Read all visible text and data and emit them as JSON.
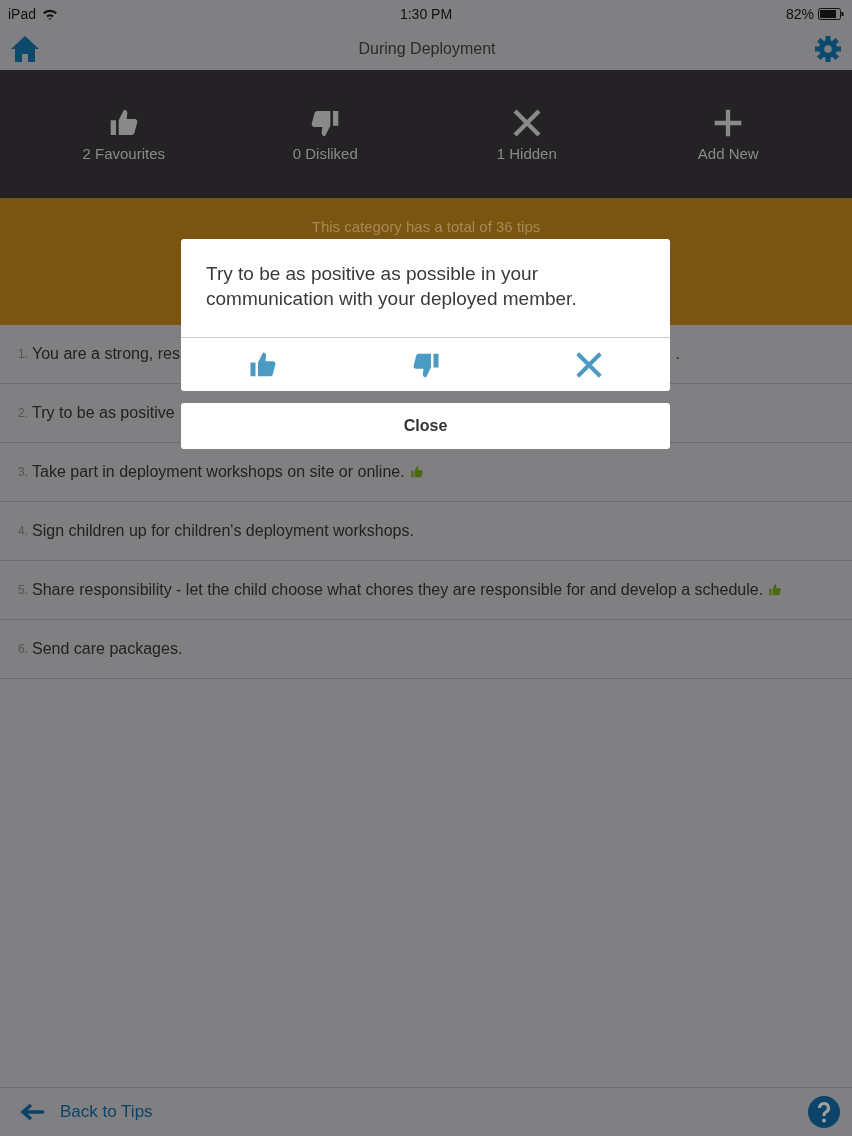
{
  "status_bar": {
    "carrier": "iPad",
    "time": "1:30 PM",
    "battery": "82%"
  },
  "header": {
    "title": "During Deployment"
  },
  "toolbar": [
    {
      "kind": "thumbs_up",
      "label": "2 Favourites"
    },
    {
      "kind": "thumbs_down",
      "label": "0 Disliked"
    },
    {
      "kind": "hidden",
      "label": "1 Hidden"
    },
    {
      "kind": "add",
      "label": "Add New"
    }
  ],
  "banner": {
    "text": "This category has a total of 36 tips"
  },
  "tips": [
    {
      "number": "1.",
      "text": "You are a strong, res",
      "tail": "."
    },
    {
      "number": "2.",
      "text": "Try to be as positive"
    },
    {
      "number": "3.",
      "text": "Take part in deployment workshops on site or online.",
      "favourite": true
    },
    {
      "number": "4.",
      "text": "Sign children up for children's deployment workshops.",
      "favourite": false
    },
    {
      "number": "5.",
      "text": "Share responsibility - let the child choose what chores they are responsible for and develop a schedule.",
      "favourite": true
    },
    {
      "number": "6.",
      "text": "Send care packages.",
      "favourite": false
    }
  ],
  "dialog": {
    "message": "Try to be as positive as possible in your communication with your deployed member.",
    "actions": [
      {
        "kind": "thumbs_up"
      },
      {
        "kind": "thumbs_down"
      },
      {
        "kind": "hidden"
      }
    ],
    "close_label": "Close"
  },
  "footer": {
    "back_label": "Back to Tips"
  }
}
